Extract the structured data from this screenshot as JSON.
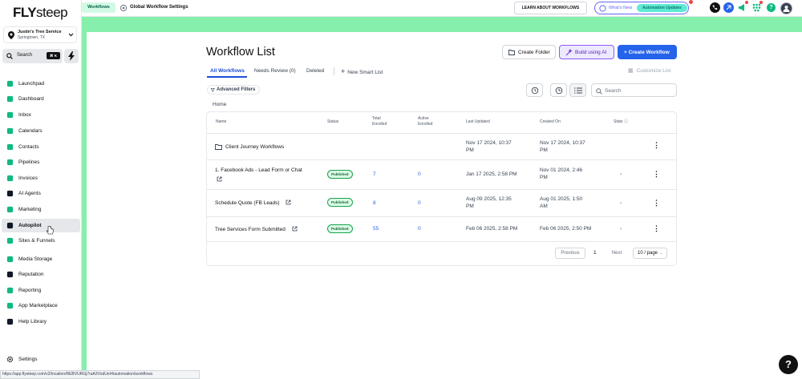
{
  "brand": {
    "logo_bold": "FLY",
    "logo_rest": "steep"
  },
  "location": {
    "name": "Justin's Tree Service",
    "city": "Springtown, TX"
  },
  "search": {
    "label": "Search",
    "shortcut": "⌘ K"
  },
  "sidebar": {
    "items": [
      {
        "label": "Launchpad",
        "icon": "rocket-icon",
        "color": "#10b981"
      },
      {
        "label": "Dashboard",
        "icon": "dashboard-icon",
        "color": "#10b981"
      },
      {
        "label": "Inbox",
        "icon": "inbox-icon",
        "color": "#10b981"
      },
      {
        "label": "Calendars",
        "icon": "calendar-icon",
        "color": "#10b981"
      },
      {
        "label": "Contacts",
        "icon": "contacts-icon",
        "color": "#10b981"
      },
      {
        "label": "Pipelines",
        "icon": "pipelines-icon",
        "color": "#10b981"
      },
      {
        "label": "Invoices",
        "icon": "invoice-icon",
        "color": "#10b981"
      },
      {
        "label": "AI Agents",
        "icon": "ai-agent-icon",
        "color": "#111827"
      },
      {
        "label": "Marketing",
        "icon": "megaphone-icon",
        "color": "#10b981"
      },
      {
        "label": "Autopilot",
        "icon": "autopilot-icon",
        "color": "#111827"
      },
      {
        "label": "Sites & Funnels",
        "icon": "sites-icon",
        "color": "#10b981"
      },
      {
        "label": "Media Storage",
        "icon": "media-icon",
        "color": "#10b981"
      },
      {
        "label": "Reputation",
        "icon": "star-icon",
        "color": "#111827"
      },
      {
        "label": "Reporting",
        "icon": "reporting-icon",
        "color": "#10b981"
      },
      {
        "label": "App Marketplace",
        "icon": "marketplace-icon",
        "color": "#10b981"
      },
      {
        "label": "Help Library",
        "icon": "help-icon",
        "color": "#111827"
      }
    ],
    "settings": "Settings"
  },
  "topbar": {
    "section": "Workflows",
    "global_settings": "Global Workflow Settings",
    "learn": "LEARN ABOUT WORKFLOWS",
    "whats_new": "What's New",
    "update_pill": "Automation Updates"
  },
  "page": {
    "title": "Workflow List",
    "create_folder": "Create Folder",
    "build_ai": "Build using AI",
    "create_workflow": "+ Create Workflow",
    "tabs": [
      "All Workflows",
      "Needs Review (0)",
      "Deleted"
    ],
    "new_smart_list": "New Smart List",
    "customize": "Customize List",
    "advanced_filters": "Advanced Filters",
    "search_placeholder": "Search",
    "breadcrumb": "Home"
  },
  "table": {
    "headers": {
      "name": "Name",
      "status": "Status",
      "total_1": "Total",
      "total_2": "Enrolled",
      "active_1": "Active",
      "active_2": "Enrolled",
      "updated": "Last Updated",
      "created": "Created On",
      "stats": "Stats"
    },
    "rows": [
      {
        "type": "folder",
        "name": "Client Journey Workflows",
        "updated_1": "Nov 17 2024, 10:37",
        "updated_2": "PM",
        "created_1": "Nov 17 2024, 10:37",
        "created_2": "PM"
      },
      {
        "type": "workflow",
        "name_1": "1. Facebook Ads - Lead Form or Chat",
        "status": "Published",
        "total": "7",
        "active": "0",
        "updated_1": "Jan 17 2025, 2:58 PM",
        "updated_2": "",
        "created_1": "Nov 01 2024, 2:46",
        "created_2": "PM"
      },
      {
        "type": "workflow",
        "name_1": "Schedule Quote (FB Leads)",
        "status": "Published",
        "total": "8",
        "active": "0",
        "updated_1": "Aug 09 2025, 12:35",
        "updated_2": "PM",
        "created_1": "Aug 01 2025, 1:50",
        "created_2": "AM"
      },
      {
        "type": "workflow",
        "name_1": "Tree Services Form Submitted",
        "status": "Published",
        "total": "55",
        "active": "0",
        "updated_1": "Feb 06 2025, 2:58 PM",
        "updated_2": "",
        "created_1": "Feb 06 2025, 2:50 PM",
        "created_2": ""
      }
    ]
  },
  "pagination": {
    "previous": "Previous",
    "page": "1",
    "next": "Next",
    "per_page": "10 / page"
  },
  "help_button": "?",
  "status_url": "https://app.flysteep.com/v2/location/REBVURGj7raA3VodUeI4/automation/workflows",
  "colors": {
    "accent": "#2563eb",
    "published": "#16a34a",
    "green_bg": "#86efac"
  }
}
